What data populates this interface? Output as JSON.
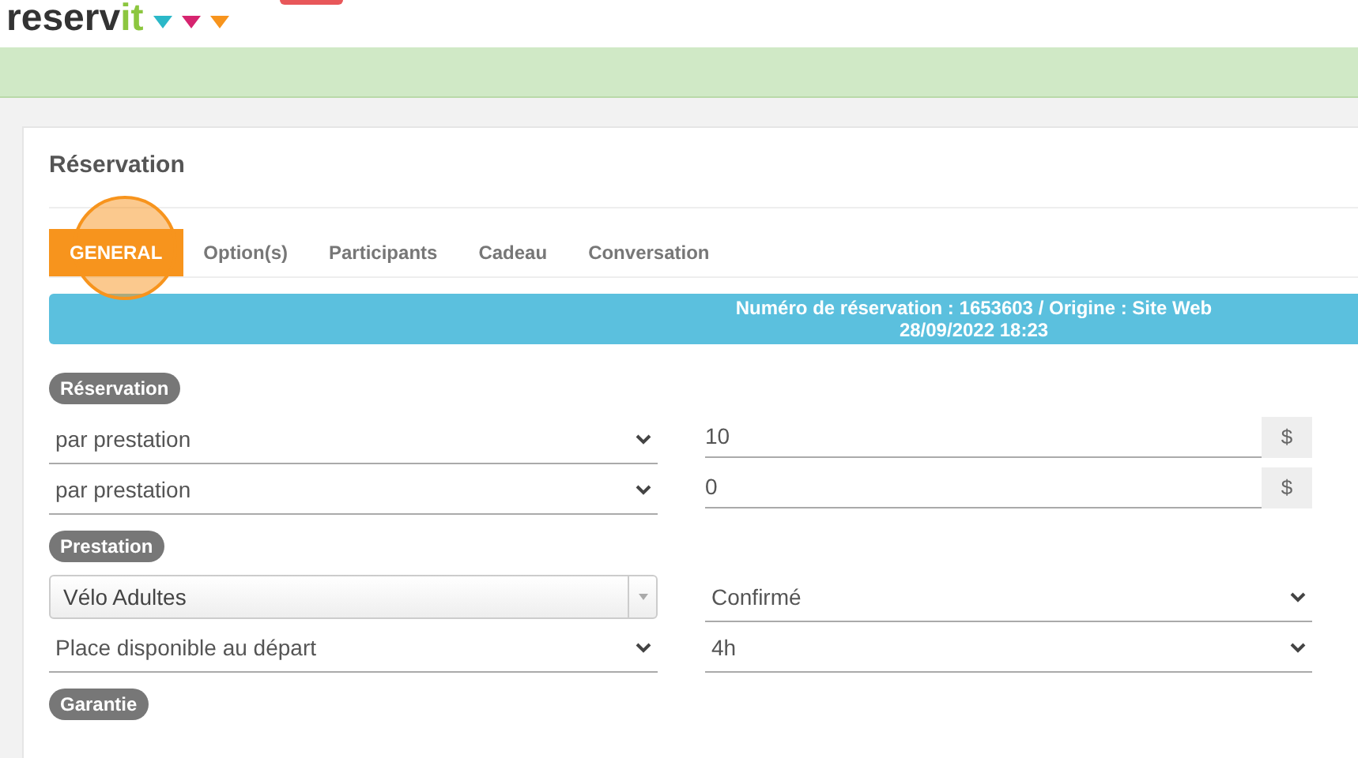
{
  "header": {
    "logo": {
      "main": "reserv",
      "accent": "it"
    }
  },
  "card": {
    "title": "Réservation",
    "tabs": [
      {
        "label": "GENERAL",
        "selected": true
      },
      {
        "label": "Option(s)",
        "selected": false
      },
      {
        "label": "Participants",
        "selected": false
      },
      {
        "label": "Cadeau",
        "selected": false
      },
      {
        "label": "Conversation",
        "selected": false
      }
    ],
    "banner": [
      "Numéro de réservation : 1653603 / Origine : Site Web",
      "28/09/2022 18:23"
    ],
    "sections": [
      {
        "badge": "Réservation",
        "rows": [
          [
            {
              "kind": "select",
              "value": "par prestation"
            },
            {
              "kind": "amount",
              "value": "10",
              "unit": "$"
            }
          ],
          [
            {
              "kind": "select",
              "value": "par prestation"
            },
            {
              "kind": "amount",
              "value": "0",
              "unit": "$"
            }
          ]
        ]
      },
      {
        "badge": "Prestation",
        "rows": [
          [
            {
              "kind": "combo",
              "value": "Vélo Adultes"
            },
            {
              "kind": "select",
              "value": "Confirmé"
            }
          ],
          [
            {
              "kind": "select",
              "value": "Place disponible au départ"
            },
            {
              "kind": "select",
              "value": "4h"
            }
          ]
        ]
      },
      {
        "badge": "Garantie"
      }
    ]
  }
}
